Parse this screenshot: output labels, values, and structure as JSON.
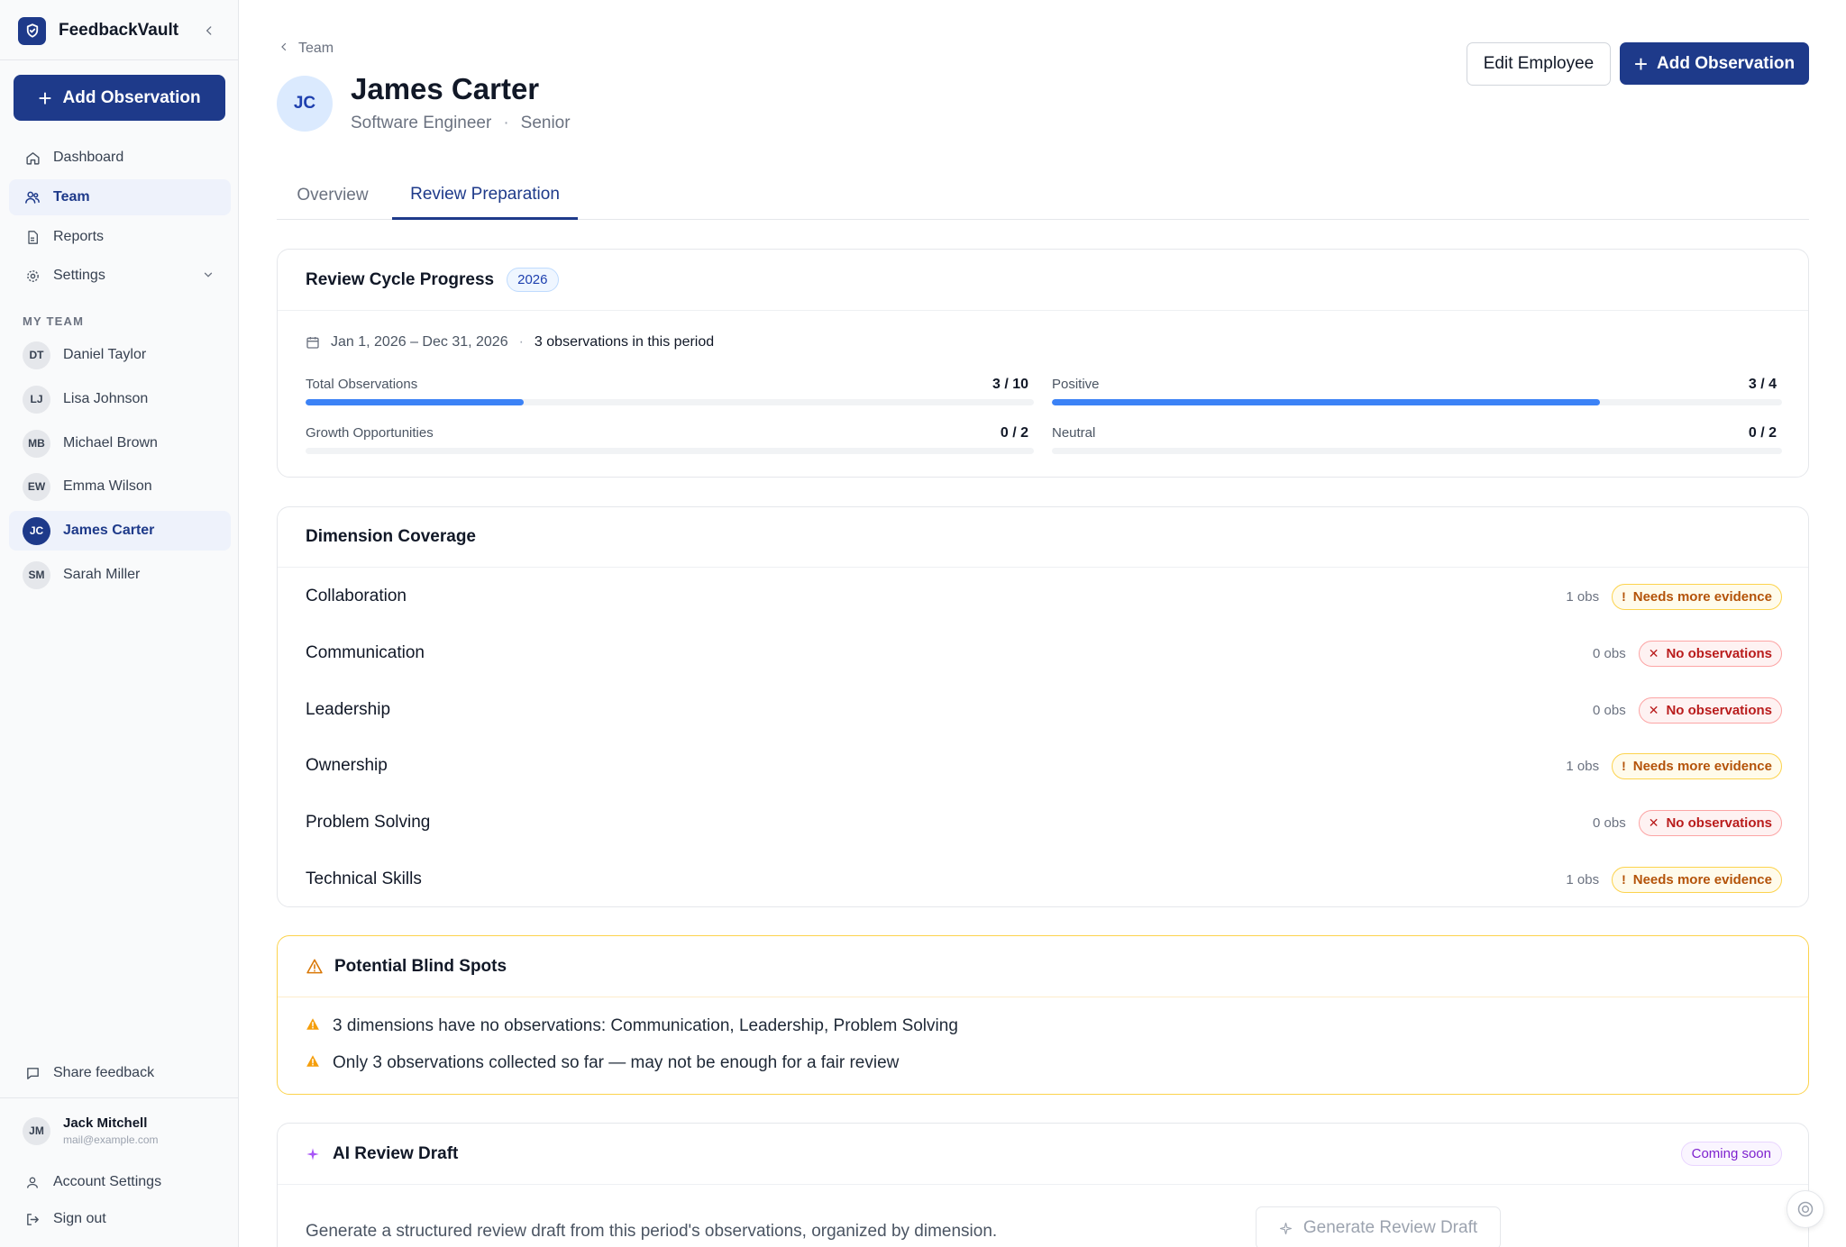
{
  "app": {
    "name": "FeedbackVault"
  },
  "sidebar": {
    "add_button": "Add Observation",
    "nav": [
      {
        "label": "Dashboard",
        "icon": "home-icon"
      },
      {
        "label": "Team",
        "icon": "users-icon",
        "active": true
      },
      {
        "label": "Reports",
        "icon": "file-icon"
      },
      {
        "label": "Settings",
        "icon": "gear-icon"
      }
    ],
    "section_label": "MY TEAM",
    "members": [
      {
        "initials": "DT",
        "name": "Daniel Taylor"
      },
      {
        "initials": "LJ",
        "name": "Lisa Johnson"
      },
      {
        "initials": "MB",
        "name": "Michael Brown"
      },
      {
        "initials": "EW",
        "name": "Emma Wilson"
      },
      {
        "initials": "JC",
        "name": "James Carter",
        "active": true
      },
      {
        "initials": "SM",
        "name": "Sarah Miller"
      }
    ],
    "share_feedback": "Share feedback",
    "user": {
      "initials": "JM",
      "name": "Jack Mitchell",
      "email": "mail@example.com"
    },
    "account_settings": "Account Settings",
    "sign_out": "Sign out"
  },
  "header": {
    "breadcrumb": "Team",
    "avatar_initials": "JC",
    "name": "James Carter",
    "role": "Software Engineer",
    "level": "Senior",
    "edit_button": "Edit Employee",
    "add_button": "Add Observation"
  },
  "tabs": [
    {
      "label": "Overview",
      "active": false
    },
    {
      "label": "Review Preparation",
      "active": true
    }
  ],
  "review_cycle": {
    "title": "Review Cycle Progress",
    "year": "2026",
    "period": "Jan 1, 2026 – Dec 31, 2026",
    "count_text": "3 observations in this period",
    "metrics": [
      {
        "label": "Total Observations",
        "value": "3 / 10",
        "progress": 0.3
      },
      {
        "label": "Positive",
        "value": "3 / 4",
        "progress": 0.75
      },
      {
        "label": "Growth Opportunities",
        "value": "0 / 2",
        "progress": 0
      },
      {
        "label": "Neutral",
        "value": "0 / 2",
        "progress": 0
      }
    ]
  },
  "dimension_coverage": {
    "title": "Dimension Coverage",
    "rows": [
      {
        "name": "Collaboration",
        "count": "1 obs",
        "status": "Needs more evidence",
        "type": "warn"
      },
      {
        "name": "Communication",
        "count": "0 obs",
        "status": "No observations",
        "type": "err"
      },
      {
        "name": "Leadership",
        "count": "0 obs",
        "status": "No observations",
        "type": "err"
      },
      {
        "name": "Ownership",
        "count": "1 obs",
        "status": "Needs more evidence",
        "type": "warn"
      },
      {
        "name": "Problem Solving",
        "count": "0 obs",
        "status": "No observations",
        "type": "err"
      },
      {
        "name": "Technical Skills",
        "count": "1 obs",
        "status": "Needs more evidence",
        "type": "warn"
      }
    ]
  },
  "blind_spots": {
    "title": "Potential Blind Spots",
    "items": [
      "3 dimensions have no observations: Communication, Leadership, Problem Solving",
      "Only 3 observations collected so far — may not be enough for a fair review"
    ]
  },
  "ai_draft": {
    "title": "AI Review Draft",
    "badge": "Coming soon",
    "description": "Generate a structured review draft from this period's observations, organized by dimension.",
    "button": "Generate Review Draft"
  },
  "colors": {
    "primary": "#1e3a8a",
    "progress": "#3b82f6",
    "warning": "#b45309",
    "error": "#b91c1c",
    "purple": "#7e22ce"
  }
}
